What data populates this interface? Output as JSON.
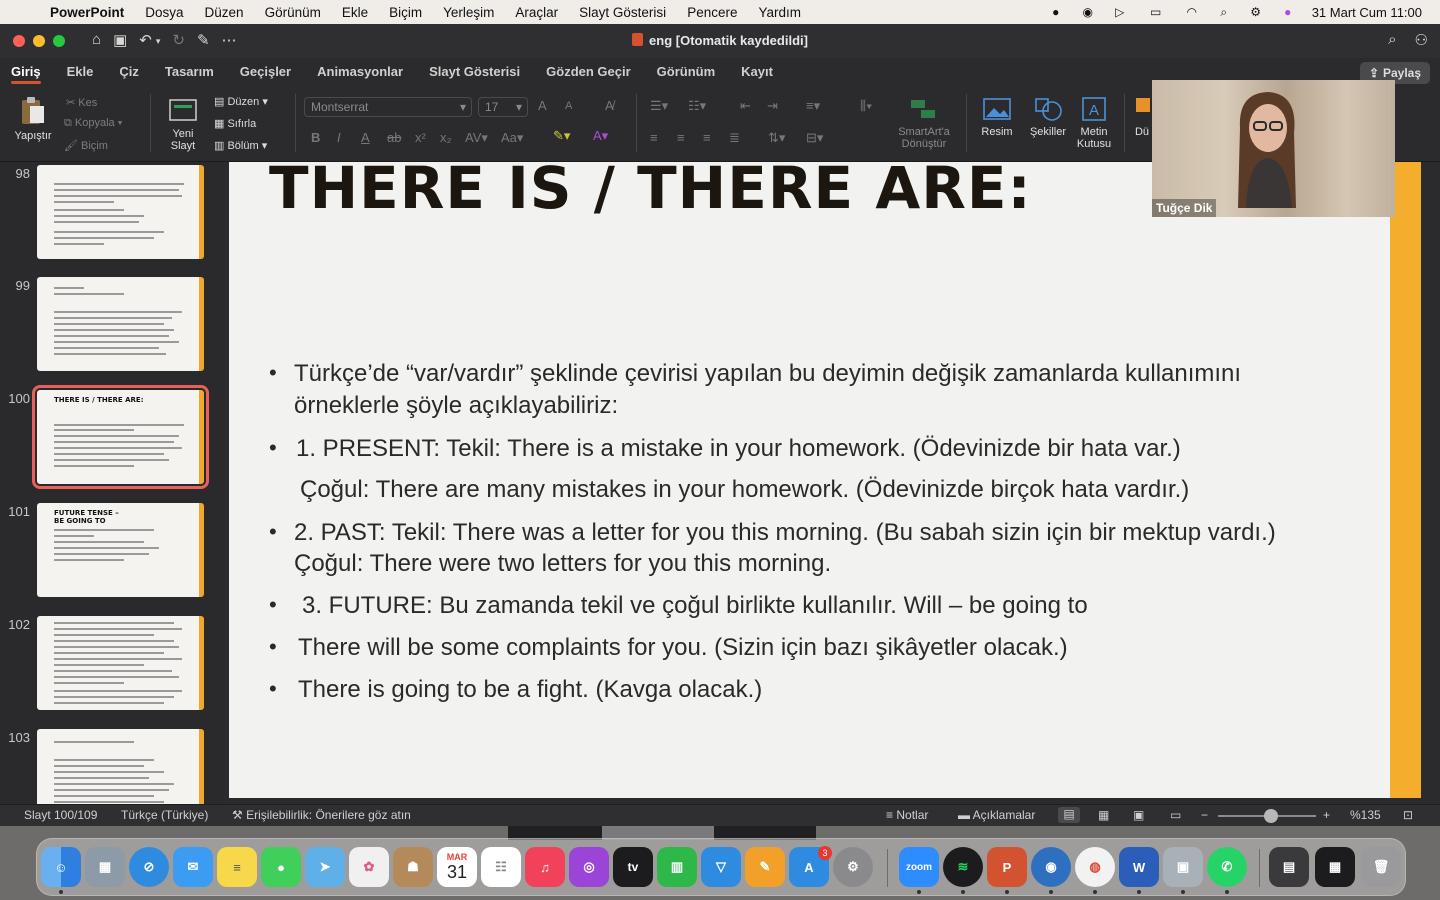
{
  "menubar": {
    "app": "PowerPoint",
    "items": [
      "Dosya",
      "Düzen",
      "Görünüm",
      "Ekle",
      "Biçim",
      "Yerleşim",
      "Araçlar",
      "Slayt Gösterisi",
      "Pencere",
      "Yardım"
    ],
    "clock": "31 Mart Cum  11:00"
  },
  "window": {
    "title": "eng [Otomatik kaydedildi]"
  },
  "ribbon": {
    "tabs": [
      "Giriş",
      "Ekle",
      "Çiz",
      "Tasarım",
      "Geçişler",
      "Animasyonlar",
      "Slayt Gösterisi",
      "Gözden Geçir",
      "Görünüm",
      "Kayıt"
    ],
    "active_tab": "Giriş",
    "share": "Paylaş",
    "paste": "Yapıştır",
    "cut": "Kes",
    "copy": "Kopyala",
    "format": "Biçim",
    "new_slide_1": "Yeni",
    "new_slide_2": "Slayt",
    "layout": "Düzen",
    "reset": "Sıfırla",
    "section": "Bölüm",
    "font_name": "Montserrat",
    "font_size": "17",
    "smartart_1": "SmartArt'a",
    "smartart_2": "Dönüştür",
    "picture": "Resim",
    "shapes": "Şekiller",
    "textbox_1": "Metin",
    "textbox_2": "Kutusu",
    "arrange_partial": "Dü"
  },
  "thumbnails": [
    {
      "num": "98",
      "title": ""
    },
    {
      "num": "99",
      "title": ""
    },
    {
      "num": "100",
      "title": "THERE IS / THERE ARE:"
    },
    {
      "num": "101",
      "title": "FUTURE TENSE – BE GOING TO"
    },
    {
      "num": "102",
      "title": ""
    },
    {
      "num": "103",
      "title": ""
    }
  ],
  "selected_thumbnail": "100",
  "slide": {
    "title": "THERE IS / THERE ARE:",
    "lines": [
      "Türkçe’de “var/vardır” şeklinde çevirisi yapılan bu deyimin değişik zamanlarda kullanımını",
      "örneklerle şöyle açıklayabiliriz:",
      "1. PRESENT: Tekil: There is a mistake in your homework. (Ödevinizde bir hata var.)",
      "Çoğul: There are many mistakes in your homework. (Ödevinizde birçok hata vardır.)",
      "2. PAST: Tekil: There was a letter for you this morning. (Bu sabah sizin için bir mektup vardı.)",
      "Çoğul: There were two letters for you this morning.",
      "3. FUTURE: Bu zamanda tekil ve çoğul birlikte kullanılır.  Will – be going to",
      "There will be some complaints for you. (Sizin için bazı şikâyetler olacak.)",
      "There is going to be a fight. (Kavga olacak.)"
    ]
  },
  "video": {
    "participant": "Tuğçe Dik"
  },
  "status": {
    "slide_counter": "Slayt 100/109",
    "language": "Türkçe (Türkiye)",
    "accessibility": "Erişilebilirlik: Önerilere göz atın",
    "notes": "Notlar",
    "comments": "Açıklamalar",
    "zoom": "%135"
  },
  "dock": {
    "calendar_month": "MAR",
    "calendar_day": "31",
    "appstore_badge": "3",
    "zoom_label": "zoom"
  }
}
